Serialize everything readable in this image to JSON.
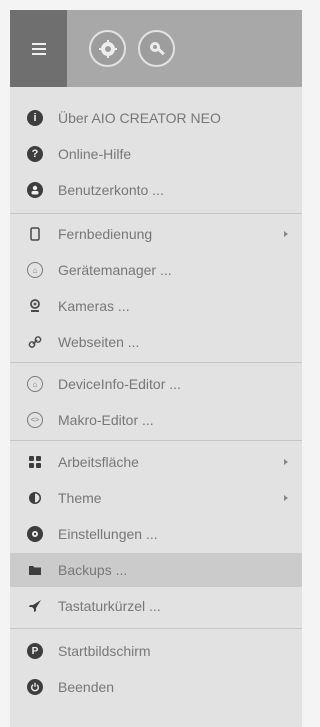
{
  "topbar": {
    "menu_icon": "hamburger-icon",
    "buttons": [
      {
        "icon": "puzzle-gear-icon"
      },
      {
        "icon": "wrench-gear-icon"
      }
    ]
  },
  "menu": {
    "items": [
      {
        "label": "Über AIO CREATOR NEO",
        "icon": "info-icon"
      },
      {
        "label": "Online-Hilfe",
        "icon": "question-icon"
      },
      {
        "label": "Benutzerkonto ...",
        "icon": "user-icon"
      },
      {
        "label": "Fernbedienung",
        "icon": "remote-icon",
        "submenu": true
      },
      {
        "label": "Gerätemanager ...",
        "icon": "device-icon"
      },
      {
        "label": "Kameras ...",
        "icon": "camera-icon"
      },
      {
        "label": "Webseiten ...",
        "icon": "link-icon"
      },
      {
        "label": "DeviceInfo-Editor ...",
        "icon": "device-info-icon"
      },
      {
        "label": "Makro-Editor ...",
        "icon": "code-icon"
      },
      {
        "label": "Arbeitsfläche",
        "icon": "grid-icon",
        "submenu": true
      },
      {
        "label": "Theme",
        "icon": "contrast-icon",
        "submenu": true
      },
      {
        "label": "Einstellungen ...",
        "icon": "gear-icon"
      },
      {
        "label": "Backups ...",
        "icon": "folder-icon"
      },
      {
        "label": "Tastaturkürzel ...",
        "icon": "rocket-icon"
      },
      {
        "label": "Startbildschirm",
        "icon": "startscreen-icon"
      },
      {
        "label": "Beenden",
        "icon": "power-icon"
      }
    ]
  }
}
